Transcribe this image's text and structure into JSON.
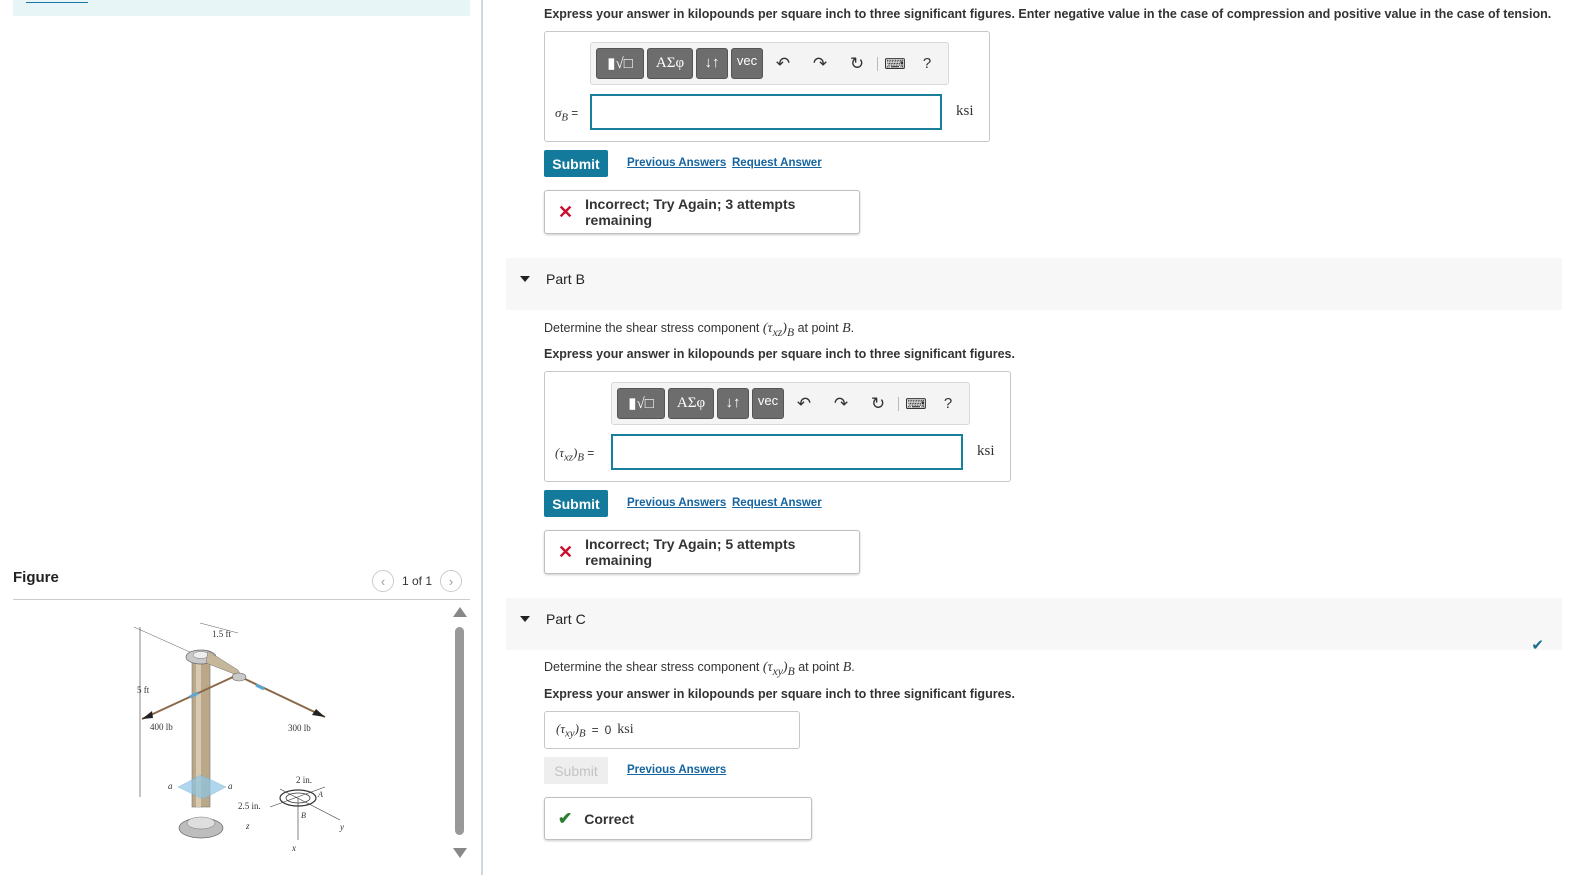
{
  "figure_pane": {
    "title": "Figure",
    "pager_text": "1 of 1",
    "labels": {
      "height": "5 ft",
      "arm": "1.5 ft",
      "left_load": "400 lb",
      "right_load": "300 lb",
      "dim_a": "2 in.",
      "dim_b": "2.5 in.",
      "point_a": "A",
      "point_b": "B",
      "section": "a",
      "axis_x": "x",
      "axis_y": "y",
      "axis_z": "z"
    }
  },
  "part_a": {
    "instruction": "Express your answer in kilopounds per square inch to three significant figures. Enter negative value in the case of compression and positive value in the case of tension.",
    "label_symbol": "σ",
    "label_sub": "B",
    "label_eq": "=",
    "unit": "ksi",
    "input_value": "",
    "submit_label": "Submit",
    "previous_answers": "Previous Answers",
    "request_answer": "Request Answer",
    "feedback": "Incorrect; Try Again; 3 attempts remaining"
  },
  "toolbar": {
    "template_btn": "▮√□",
    "greek_btn": "ΑΣφ",
    "arrows_btn": "↓↑",
    "vec_btn": "vec",
    "undo": "↶",
    "redo": "↷",
    "reset": "↻",
    "keyboard": "⌨",
    "help": "?"
  },
  "part_b": {
    "title": "Part B",
    "prompt_pre": "Determine the shear stress component",
    "prompt_symbol": "(τ",
    "prompt_sub": "xz",
    "prompt_close": ")",
    "prompt_sub2": "B",
    "prompt_post": "at point",
    "prompt_point": "B",
    "prompt_end": ".",
    "instruction": "Express your answer in kilopounds per square inch to three significant figures.",
    "label_symbol": "(τ",
    "label_sub": "xz",
    "label_close": ")",
    "label_sub2": "B",
    "label_eq": "=",
    "unit": "ksi",
    "input_value": "",
    "submit_label": "Submit",
    "previous_answers": "Previous Answers",
    "request_answer": "Request Answer",
    "feedback": "Incorrect; Try Again; 5 attempts remaining"
  },
  "part_c": {
    "title": "Part C",
    "prompt_pre": "Determine the shear stress component",
    "prompt_symbol": "(τ",
    "prompt_sub": "xy",
    "prompt_close": ")",
    "prompt_sub2": "B",
    "prompt_post": "at point",
    "prompt_point": "B",
    "prompt_end": ".",
    "instruction": "Express your answer in kilopounds per square inch to three significant figures.",
    "answer_symbol": "(τ",
    "answer_sub": "xy",
    "answer_close": ")",
    "answer_sub2": "B",
    "answer_eq": "=",
    "answer_value": "0",
    "answer_unit": "ksi",
    "submit_label": "Submit",
    "previous_answers": "Previous Answers",
    "feedback": "Correct"
  }
}
